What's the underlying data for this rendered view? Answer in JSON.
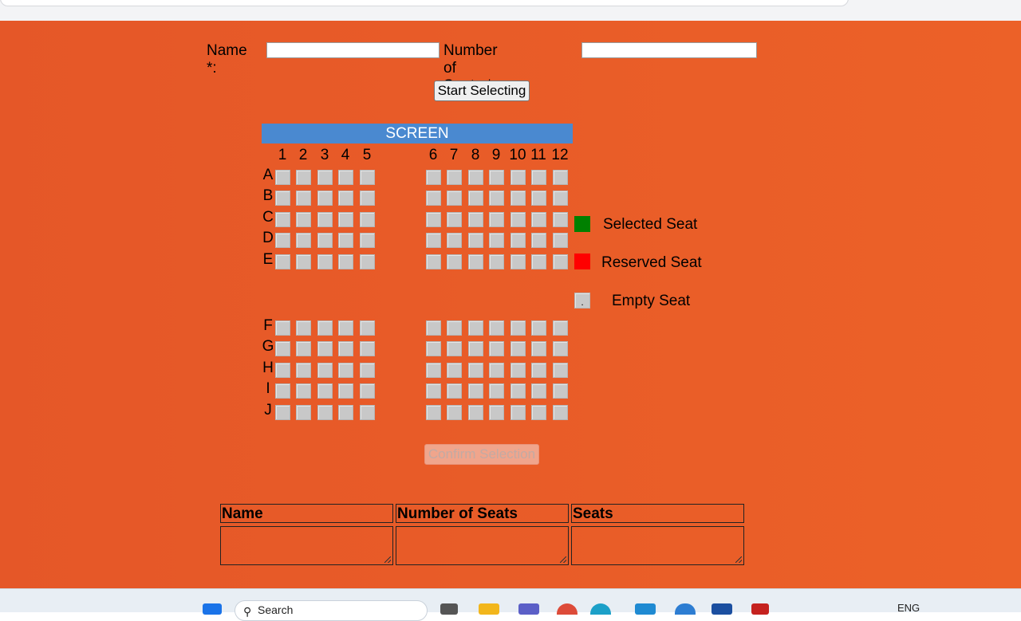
{
  "form": {
    "name_label": "Name *:",
    "name_value": "",
    "seats_label": "Number of Seats *:",
    "seats_value": "",
    "start_button": "Start Selecting"
  },
  "screen_label": "SCREEN",
  "columns": [
    "1",
    "2",
    "3",
    "4",
    "5",
    "6",
    "7",
    "8",
    "9",
    "10",
    "11",
    "12"
  ],
  "rows": [
    "A",
    "B",
    "C",
    "D",
    "E",
    "F",
    "G",
    "H",
    "I",
    "J"
  ],
  "legend": {
    "selected": {
      "label": "Selected Seat",
      "color": "#008000"
    },
    "reserved": {
      "label": "Reserved Seat",
      "color": "#ff0000"
    },
    "empty": {
      "label": "Empty Seat",
      "glyph": "."
    }
  },
  "confirm_button": "Confirm Selection",
  "table": {
    "headers": [
      "Name",
      "Number of Seats",
      "Seats"
    ],
    "values": [
      "",
      "",
      ""
    ]
  },
  "taskbar": {
    "search_text": "Search",
    "language": "ENG",
    "icons": [
      "start-icon",
      "search-icon",
      "task-view-icon",
      "file-explorer-icon",
      "teams-icon",
      "chrome-icon",
      "edge-icon",
      "vscode-icon",
      "weather-icon",
      "store-icon",
      "gmail-icon"
    ]
  }
}
